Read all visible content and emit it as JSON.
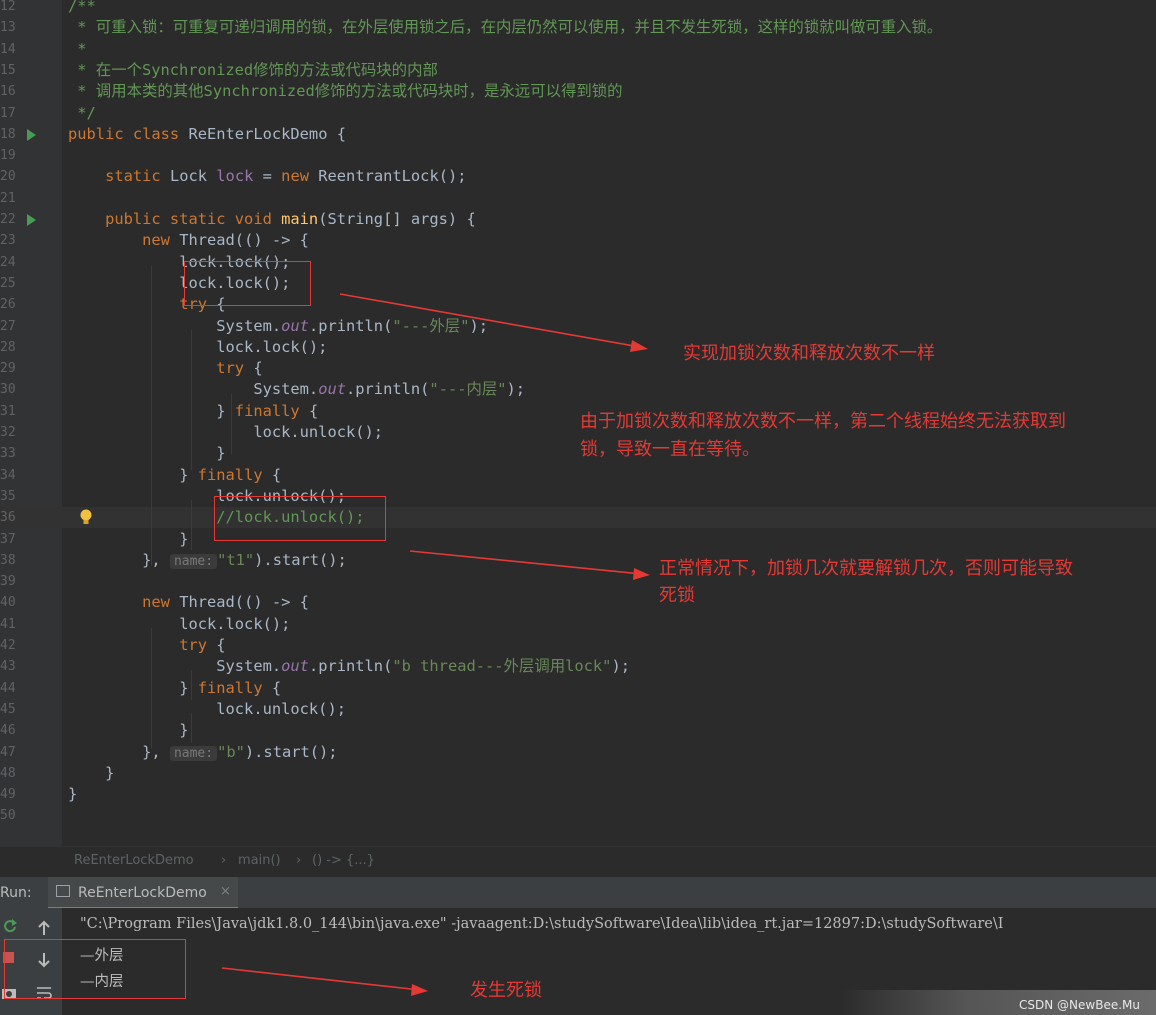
{
  "lines": [
    {
      "n": "12",
      "segs": [
        {
          "t": "/**",
          "c": "cm"
        }
      ]
    },
    {
      "n": "13",
      "segs": [
        {
          "t": " * 可重入锁：可重复可递归调用的锁，在外层使用锁之后，在内层仍然可以使用，并且不发生死锁，这样的锁就叫做可重入锁。",
          "c": "cm"
        }
      ]
    },
    {
      "n": "14",
      "segs": [
        {
          "t": " *",
          "c": "cm"
        }
      ]
    },
    {
      "n": "15",
      "segs": [
        {
          "t": " * 在一个Synchronized修饰的方法或代码块的内部",
          "c": "cm"
        }
      ]
    },
    {
      "n": "16",
      "segs": [
        {
          "t": " * 调用本类的其他Synchronized修饰的方法或代码块时，是永远可以得到锁的",
          "c": "cm"
        }
      ]
    },
    {
      "n": "17",
      "segs": [
        {
          "t": " */",
          "c": "cm"
        }
      ]
    },
    {
      "n": "18",
      "run": true,
      "segs": [
        {
          "t": "public class ",
          "c": "kw"
        },
        {
          "t": "ReEnterLockDemo",
          "c": "cls"
        },
        {
          "t": " {",
          "c": ""
        }
      ]
    },
    {
      "n": "19",
      "segs": []
    },
    {
      "n": "20",
      "segs": [
        {
          "t": "    static ",
          "c": "kw"
        },
        {
          "t": "Lock ",
          "c": "cls"
        },
        {
          "t": "lock",
          "c": "fld2"
        },
        {
          "t": " = ",
          "c": ""
        },
        {
          "t": "new ",
          "c": "kw"
        },
        {
          "t": "ReentrantLock();",
          "c": ""
        }
      ]
    },
    {
      "n": "21",
      "segs": []
    },
    {
      "n": "22",
      "run": true,
      "segs": [
        {
          "t": "    public static void ",
          "c": "kw"
        },
        {
          "t": "main",
          "c": "fn"
        },
        {
          "t": "(String[] args) {",
          "c": ""
        }
      ]
    },
    {
      "n": "23",
      "segs": [
        {
          "t": "        new ",
          "c": "kw"
        },
        {
          "t": "Thread(() -> {",
          "c": ""
        }
      ]
    },
    {
      "n": "24",
      "segs": [
        {
          "t": "            lock.lock();",
          "c": ""
        }
      ]
    },
    {
      "n": "25",
      "segs": [
        {
          "t": "            lock.lock();",
          "c": ""
        }
      ]
    },
    {
      "n": "26",
      "segs": [
        {
          "t": "            try ",
          "c": "kw"
        },
        {
          "t": "{",
          "c": ""
        }
      ]
    },
    {
      "n": "27",
      "segs": [
        {
          "t": "                System.",
          "c": ""
        },
        {
          "t": "out",
          "c": "fld"
        },
        {
          "t": ".println(",
          "c": ""
        },
        {
          "t": "\"---外层\"",
          "c": "str"
        },
        {
          "t": ");",
          "c": ""
        }
      ]
    },
    {
      "n": "28",
      "segs": [
        {
          "t": "                lock.lock();",
          "c": ""
        }
      ]
    },
    {
      "n": "29",
      "segs": [
        {
          "t": "                try ",
          "c": "kw"
        },
        {
          "t": "{",
          "c": ""
        }
      ]
    },
    {
      "n": "30",
      "segs": [
        {
          "t": "                    System.",
          "c": ""
        },
        {
          "t": "out",
          "c": "fld"
        },
        {
          "t": ".println(",
          "c": ""
        },
        {
          "t": "\"---内层\"",
          "c": "str"
        },
        {
          "t": ");",
          "c": ""
        }
      ]
    },
    {
      "n": "31",
      "segs": [
        {
          "t": "                } ",
          "c": ""
        },
        {
          "t": "finally ",
          "c": "kw"
        },
        {
          "t": "{",
          "c": ""
        }
      ]
    },
    {
      "n": "32",
      "segs": [
        {
          "t": "                    lock.unlock();",
          "c": ""
        }
      ]
    },
    {
      "n": "33",
      "segs": [
        {
          "t": "                }",
          "c": ""
        }
      ]
    },
    {
      "n": "34",
      "segs": [
        {
          "t": "            } ",
          "c": ""
        },
        {
          "t": "finally ",
          "c": "kw"
        },
        {
          "t": "{",
          "c": ""
        }
      ]
    },
    {
      "n": "35",
      "segs": [
        {
          "t": "                lock.unlock();",
          "c": ""
        }
      ]
    },
    {
      "n": "36",
      "current": true,
      "bulb": true,
      "segs": [
        {
          "t": "                //lock.unlock();",
          "c": "cm"
        }
      ]
    },
    {
      "n": "37",
      "segs": [
        {
          "t": "            }",
          "c": ""
        }
      ]
    },
    {
      "n": "38",
      "segs": [
        {
          "t": "        }, ",
          "c": ""
        },
        {
          "t": "name:",
          "c": "hint"
        },
        {
          "t": "\"t1\"",
          "c": "str"
        },
        {
          "t": ").start();",
          "c": ""
        }
      ]
    },
    {
      "n": "39",
      "segs": []
    },
    {
      "n": "40",
      "segs": [
        {
          "t": "        new ",
          "c": "kw"
        },
        {
          "t": "Thread(() -> {",
          "c": ""
        }
      ]
    },
    {
      "n": "41",
      "segs": [
        {
          "t": "            lock.lock();",
          "c": ""
        }
      ]
    },
    {
      "n": "42",
      "segs": [
        {
          "t": "            try ",
          "c": "kw"
        },
        {
          "t": "{",
          "c": ""
        }
      ]
    },
    {
      "n": "43",
      "segs": [
        {
          "t": "                System.",
          "c": ""
        },
        {
          "t": "out",
          "c": "fld"
        },
        {
          "t": ".println(",
          "c": ""
        },
        {
          "t": "\"b thread---外层调用lock\"",
          "c": "str"
        },
        {
          "t": ");",
          "c": ""
        }
      ]
    },
    {
      "n": "44",
      "segs": [
        {
          "t": "            } ",
          "c": ""
        },
        {
          "t": "finally ",
          "c": "kw"
        },
        {
          "t": "{",
          "c": ""
        }
      ]
    },
    {
      "n": "45",
      "segs": [
        {
          "t": "                lock.unlock();",
          "c": ""
        }
      ]
    },
    {
      "n": "46",
      "segs": [
        {
          "t": "            }",
          "c": ""
        }
      ]
    },
    {
      "n": "47",
      "segs": [
        {
          "t": "        }, ",
          "c": ""
        },
        {
          "t": "name:",
          "c": "hint"
        },
        {
          "t": "\"b\"",
          "c": "str"
        },
        {
          "t": ").start();",
          "c": ""
        }
      ]
    },
    {
      "n": "48",
      "segs": [
        {
          "t": "    }",
          "c": ""
        }
      ]
    },
    {
      "n": "49",
      "segs": [
        {
          "t": "}",
          "c": ""
        }
      ]
    },
    {
      "n": "50",
      "segs": []
    }
  ],
  "annotations": {
    "a1": "实现加锁次数和释放次数不一样",
    "a2_line1": "由于加锁次数和释放次数不一样，第二个线程始终无法获取到",
    "a2_line2": "锁，导致一直在等待。",
    "a3_line1": "正常情况下，加锁几次就要解锁几次，否则可能导致",
    "a3_line2": "死锁",
    "a4": "发生死锁"
  },
  "breadcrumb": {
    "class": "ReEnterLockDemo",
    "method": "main()",
    "lambda": "() -> {...}"
  },
  "run": {
    "label": "Run:",
    "tab": "ReEnterLockDemo",
    "close": "×"
  },
  "console": {
    "cmd": "\"C:\\Program Files\\Java\\jdk1.8.0_144\\bin\\java.exe\" -javaagent:D:\\studySoftware\\Idea\\lib\\idea_rt.jar=12897:D:\\studySoftware\\I",
    "out1": "—外层",
    "out2": "—内层"
  },
  "watermark": "CSDN @NewBee.Mu",
  "colors": {
    "keyword": "#cc7832",
    "comment": "#629755",
    "string": "#6a8759",
    "field": "#9876aa",
    "annotation": "#e53935"
  }
}
